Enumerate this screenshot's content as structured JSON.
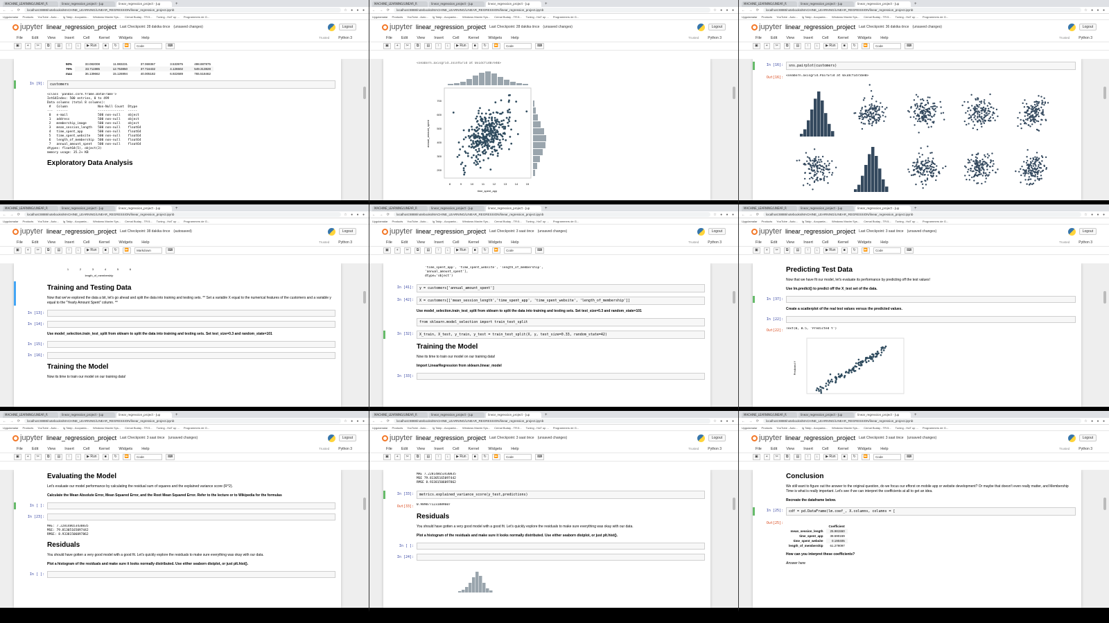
{
  "browser": {
    "tab_title": "linear_regression_project - Jup",
    "tab_title_short": "MACHINE_LEARNING/LINEAR_R",
    "url": "localhost:8888/notebooks/MACHINE_LEARNING/LINEAR_REGRESSION/linear_regression_project.ipynb",
    "bookmarks": [
      "Uygulamalar",
      "Products",
      "YouTube - Auto...",
      "Ig Takip - Accpanta...",
      "Windows Maxim Sys...",
      "Cemal Buday - TR:5...",
      "Tuning - HaT up ...",
      "Programmers de G..."
    ]
  },
  "jupyter": {
    "logo_text": "jupyter",
    "notebook_name": "linear_regression_project",
    "logout": "Logout",
    "menus": [
      "File",
      "Edit",
      "View",
      "Insert",
      "Cell",
      "Kernel",
      "Widgets",
      "Help"
    ],
    "trusted": "Trusted",
    "kernel": "Python 3",
    "run_label": "Run",
    "cell_type_code": "Code",
    "cell_type_md": "Markdown"
  },
  "panes": [
    {
      "checkpoint": "Last Checkpoint: 28 dakika önce",
      "status": "(unsaved changes)",
      "describe_rows": [
        [
          "50%",
          "33.082008",
          "11.983231",
          "37.069367",
          "3.533975",
          "498.887875"
        ],
        [
          "75%",
          "33.711985",
          "12.753850",
          "37.716432",
          "4.126502",
          "549.313828"
        ],
        [
          "max",
          "36.139662",
          "15.126994",
          "40.005182",
          "6.922689",
          "765.518462"
        ]
      ],
      "cell_prompt": "In [9]:",
      "cell_code": "customers",
      "info_output": "<class 'pandas.core.frame.DataFrame'>\nInt64Index: 500 entries, 0 to 499\nData columns (total 8 columns):\n #   Column                Non-Null Count  Dtype  \n---  ------                --------------  -----  \n 0   e-mail                500 non-null    object \n 1   address               500 non-null    object \n 2   membership_image      500 non-null    object \n 3   mean_session_length   500 non-null    float64\n 4   time_spent_app        500 non-null    float64\n 5   time_spent_website    500 non-null    float64\n 6   length_of_membership  500 non-null    float64\n 7   annual_amount_spent   500 non-null    float64\ndtypes: float64(5), object(3)\nmemory usage: 35.2+ KB",
      "heading": "Exploratory Data Analysis"
    },
    {
      "checkpoint": "Last Checkpoint: 28 dakika önce",
      "status": "(unsaved changes)",
      "top_output": "<seaborn.axisgrid.JointGrid at 0x1dcf1407e40>",
      "xlabel": "time_spent_app",
      "ylabel": "annual_amount_spent",
      "x_ticks": [
        "8",
        "9",
        "10",
        "11",
        "12",
        "13",
        "14",
        "15"
      ],
      "y_ticks": [
        "200",
        "300",
        "400",
        "500",
        "600",
        "700"
      ]
    },
    {
      "checkpoint": "Last Checkpoint: 36 dakika önce",
      "status": "(unsaved changes)",
      "in_prompt": "In [16]:",
      "in_code": "sns.pairplot(customers)",
      "out_prompt": "Out[16]:",
      "out_text": "<seaborn.axisgrid.PairGrid at 0x1dcf1d75be0>"
    },
    {
      "checkpoint": "Last Checkpoint: 38 dakika önce",
      "status": "(autosaved)",
      "xlabel_top": "length_of_membership",
      "x_ticks": [
        "1",
        "2",
        "3",
        "4",
        "5",
        "6"
      ],
      "heading1": "Training and Testing Data",
      "text1": "Now that we've explored the data a bit, let's go ahead and split the data into training and testing sets. ** Set a variable X equal to the numerical features of the customers and a variable y equal to the \"Yearly Amount Spent\" column. **",
      "p13": "In [13]:",
      "p14": "In [14]:",
      "bold1": "Use model_selection.train_test_split from sklearn to split the data into training and testing sets. Set test_size=0.3 and random_state=101",
      "p15": "In [15]:",
      "p16": "In [16]:",
      "heading2": "Training the Model",
      "text2": "Now its time to train our model on our training data!"
    },
    {
      "checkpoint": "Last Checkpoint: 3 saat önce",
      "status": "(unsaved changes)",
      "top_code": "'time_spent_app', 'time_spent_website', 'length_of_membership',\n'annual_amount_spent'],\ndtype='object')",
      "p41": "In [41]:",
      "c41": "y = customers['annual_amount_spent']",
      "p42": "In [42]:",
      "c42": "X = customers[['mean_session_length','time_spent_app', 'time_spent_website', 'length_of_membership']]",
      "bold1": "Use model_selection.train_test_split from sklearn to split the data into training and testing sets. Set test_size=0.3 and random_state=101",
      "c_imp": "from sklearn.model_selection import train_test_split",
      "p32": "In [32]:",
      "c32": "X_train, X_test, y_train, y_test = train_test_split(X, y, test_size=0.33, random_state=42)",
      "heading": "Training the Model",
      "text": "Now its time to train our model on our training data!",
      "bold2": "Import LinearRegression from sklearn.linear_model",
      "p33": "In [33]:"
    },
    {
      "checkpoint": "Last Checkpoint: 3 saat önce",
      "status": "(unsaved changes)",
      "heading": "Predicting Test Data",
      "text": "Now that we have fit our model, let's evaluate its performance by predicting off the test values!",
      "bold1": "Use lm.predict() to predict off the X_test set of the data.",
      "p37": "In [37]:",
      "bold2": "Create a scatterplot of the real test values versus the predicted values.",
      "p22": "In [22]:",
      "o22": "Out[22]:",
      "out_text": "Text(0, 0.5, 'Predicted Y')",
      "ylabel": "Predicted Y"
    },
    {
      "checkpoint": "Last Checkpoint: 3 saat önce",
      "status": "(unsaved changes)",
      "heading1": "Evaluating the Model",
      "text1": "Let's evaluate our model performance by calculating the residual sum of squares and the explained variance score (R^2).",
      "bold1": "Calculate the Mean Absolute Error, Mean Squared Error, and the Root Mean Squared Error. Refer to the lecture or to Wikipedia for the formulas",
      "pe": "In [ ]:",
      "p23": "In [23]:",
      "metrics": "MAE: 7.228148653430835\nMSE: 79.81305165097442\nRMSE: 8.93381506097862",
      "heading2": "Residuals",
      "text2": "You should have gotten a very good model with a good fit. Let's quickly explore the residuals to make sure everything was okay with our data.",
      "bold2": "Plot a histogram of the residuals and make sure it looks normally distributed. Use either seaborn distplot, or just plt.hist().",
      "pe2": "In [ ]:"
    },
    {
      "checkpoint": "Last Checkpoint: 3 saat önce",
      "status": "(unsaved changes)",
      "metrics": "MAE 7.228148653430835\nMSE 79.81305165097442\nRMSE 8.93381506097862",
      "p33": "In [33]:",
      "c33": "metrics.explained_variance_score(y_test,predictions)",
      "o33": "Out[33]:",
      "out33": "0.9890771231889607",
      "heading": "Residuals",
      "text": "You should have gotten a very good model with a good fit. Let's quickly explore the residuals to make sure everything was okay with our data.",
      "bold": "Plot a histogram of the residuals and make sure it looks normally distributed. Use either seaborn distplot, or just plt.hist().",
      "pe": "In [ ]:",
      "p24": "In [24]:"
    },
    {
      "checkpoint": "Last Checkpoint: 3 saat önce",
      "status": "(unsaved changes)",
      "heading": "Conclusion",
      "text": "We still want to figure out the answer to the original question, do we focus our efforst on mobile app or website development? Or maybe that doesn't even really matter, and Membership Time is what is really important. Let's see if we can interpret the coefficients at all to get an idea.",
      "bold": "Recreate the dataframe below.",
      "p25": "In [25]:",
      "c25": "cdf = pd.DataFrame(lm.coef_, X.columns, columns = [",
      "o25": "Out[25]:",
      "coef_header": "Coefficient",
      "coef_rows": [
        [
          "mean_session_length",
          "25.981550"
        ],
        [
          "time_spent_app",
          "38.590159"
        ],
        [
          "time_spent_website",
          "0.190405"
        ],
        [
          "length_of_membership",
          "61.279097"
        ]
      ],
      "question": "How can you interpret these coefficients?",
      "answer": "Answer here"
    }
  ]
}
